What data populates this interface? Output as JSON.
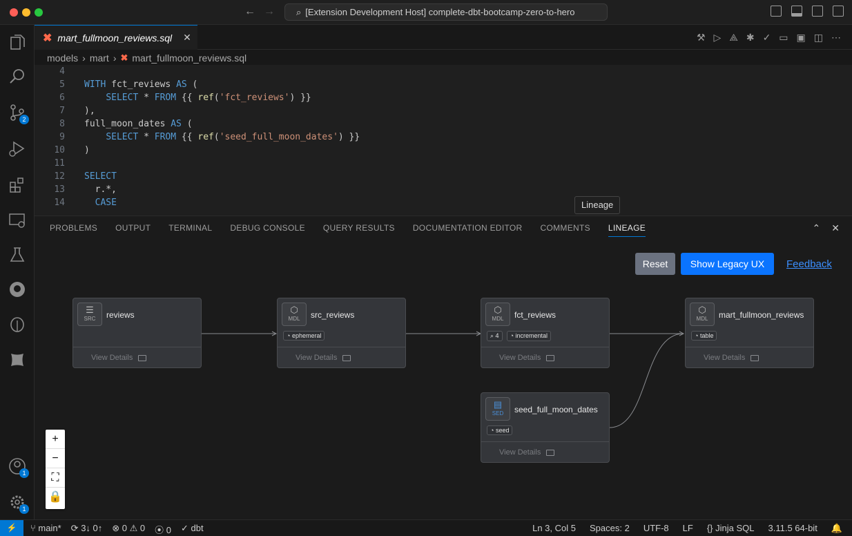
{
  "window": {
    "title": "[Extension Development Host] complete-dbt-bootcamp-zero-to-hero"
  },
  "activity_bar": {
    "source_control_badge": "2",
    "accounts_badge": "1",
    "settings_badge": "1"
  },
  "editor": {
    "tab_label": "mart_fullmoon_reviews.sql",
    "breadcrumb": [
      "models",
      "mart",
      "mart_fullmoon_reviews.sql"
    ],
    "lines": [
      {
        "num": "4",
        "text": ""
      },
      {
        "num": "5",
        "text": "WITH fct_reviews AS ("
      },
      {
        "num": "6",
        "text": "    SELECT * FROM {{ ref('fct_reviews') }}"
      },
      {
        "num": "7",
        "text": "),"
      },
      {
        "num": "8",
        "text": "full_moon_dates AS ("
      },
      {
        "num": "9",
        "text": "    SELECT * FROM {{ ref('seed_full_moon_dates') }}"
      },
      {
        "num": "10",
        "text": ")"
      },
      {
        "num": "11",
        "text": ""
      },
      {
        "num": "12",
        "text": "SELECT"
      },
      {
        "num": "13",
        "text": "  r.*,"
      },
      {
        "num": "14",
        "text": "  CASE"
      }
    ]
  },
  "panel": {
    "tooltip": "Lineage",
    "tabs": [
      "PROBLEMS",
      "OUTPUT",
      "TERMINAL",
      "DEBUG CONSOLE",
      "QUERY RESULTS",
      "DOCUMENTATION EDITOR",
      "COMMENTS",
      "LINEAGE"
    ],
    "active_tab": "LINEAGE",
    "reset_label": "Reset",
    "legacy_label": "Show Legacy UX",
    "feedback_label": "Feedback"
  },
  "lineage": {
    "view_details": "View Details",
    "nodes": [
      {
        "name": "reviews",
        "type": "SRC",
        "tags": []
      },
      {
        "name": "src_reviews",
        "type": "MDL",
        "tags": [
          "ephemeral"
        ]
      },
      {
        "name": "fct_reviews",
        "type": "MDL",
        "tags": [
          "4",
          "incremental"
        ]
      },
      {
        "name": "mart_fullmoon_reviews",
        "type": "MDL",
        "tags": [
          "table"
        ]
      },
      {
        "name": "seed_full_moon_dates",
        "type": "SED",
        "tags": [
          "seed"
        ]
      }
    ]
  },
  "statusbar": {
    "branch": "main*",
    "sync": "3↓ 0↑",
    "errors": "0",
    "warnings": "0",
    "ports": "0",
    "dbt": "dbt",
    "cursor": "Ln 3, Col 5",
    "spaces": "Spaces: 2",
    "encoding": "UTF-8",
    "eol": "LF",
    "language": "Jinja SQL",
    "python": "3.11.5 64-bit"
  }
}
